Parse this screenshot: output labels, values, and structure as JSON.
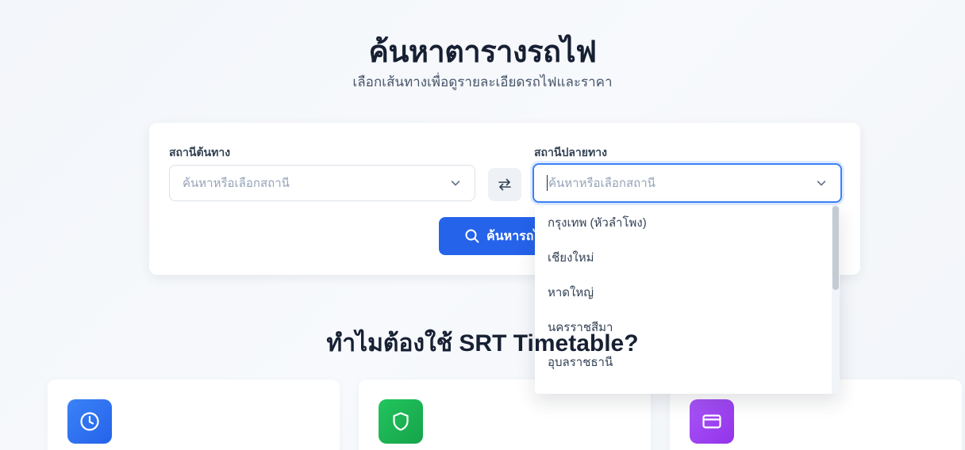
{
  "hero": {
    "title": "ค้นหาตารางรถไฟ",
    "subtitle": "เลือกเส้นทางเพื่อดูรายละเอียดรถไฟและราคา"
  },
  "search": {
    "origin_label": "สถานีต้นทาง",
    "origin_placeholder": "ค้นหาหรือเลือกสถานี",
    "destination_label": "สถานีปลายทาง",
    "destination_placeholder": "ค้นหาหรือเลือกสถานี",
    "search_button_label": "ค้นหารถไฟ"
  },
  "dropdown": {
    "options": [
      "กรุงเทพ (หัวลำโพง)",
      "เชียงใหม่",
      "หาดใหญ่",
      "นครราชสีมา",
      "อุบลราชธานี"
    ]
  },
  "why_section": {
    "title": "ทำไมต้องใช้ SRT Timetable?"
  },
  "features": [
    {
      "icon": "clock-icon",
      "color": "#3b82f6"
    },
    {
      "icon": "shield-icon",
      "color": "#22c55e"
    },
    {
      "icon": "credit-card-icon",
      "color": "#a855f7"
    }
  ],
  "colors": {
    "primary": "#2563eb",
    "focus_ring": "#3b82f6",
    "heading": "#172033"
  }
}
